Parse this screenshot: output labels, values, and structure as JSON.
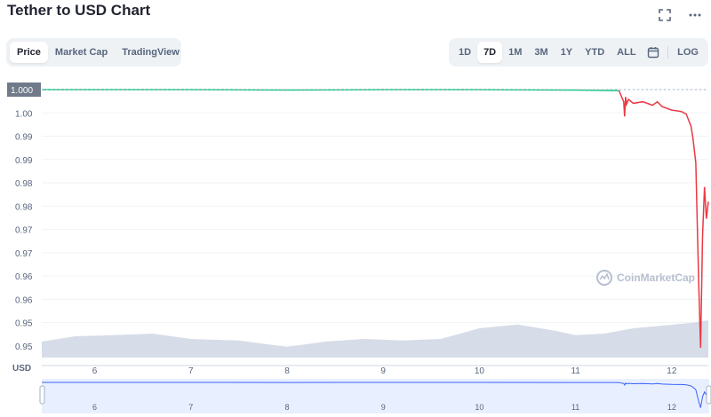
{
  "header": {
    "title": "Tether to USD Chart",
    "expand_icon": "expand-icon",
    "more_icon": "more-horizontal-icon"
  },
  "tabs_left": [
    {
      "label": "Price",
      "active": true
    },
    {
      "label": "Market Cap",
      "active": false
    },
    {
      "label": "TradingView",
      "active": false
    }
  ],
  "ranges": [
    {
      "label": "1D",
      "active": false
    },
    {
      "label": "7D",
      "active": true
    },
    {
      "label": "1M",
      "active": false
    },
    {
      "label": "3M",
      "active": false
    },
    {
      "label": "1Y",
      "active": false
    },
    {
      "label": "YTD",
      "active": false
    },
    {
      "label": "ALL",
      "active": false
    }
  ],
  "calendar_icon": "calendar-icon",
  "log_label": "LOG",
  "watermark": "CoinMarketCap",
  "colors": {
    "up": "#16c784",
    "down": "#ea3943",
    "accent": "#3861fb",
    "volume": "#cfd6e4"
  },
  "chart_data": {
    "type": "line",
    "y_axis_label": "USD",
    "yticks": [
      "1.000",
      "1.00",
      "0.99",
      "0.99",
      "0.98",
      "0.98",
      "0.97",
      "0.97",
      "0.96",
      "0.96",
      "0.95",
      "0.95"
    ],
    "xticks": [
      "6",
      "7",
      "8",
      "9",
      "10",
      "11",
      "12"
    ],
    "current_price_label": "1.000",
    "ylim": [
      0.945,
      1.0
    ],
    "grid": true,
    "series": [
      {
        "x": [
          5.45,
          6.0,
          7.0,
          8.0,
          9.0,
          10.0,
          11.0,
          11.45,
          11.5,
          11.51,
          11.52,
          11.53,
          11.55,
          11.6,
          11.7,
          11.8,
          11.85,
          11.9,
          12.0,
          12.1,
          12.15,
          12.2,
          12.22,
          12.25,
          12.28,
          12.3,
          12.32,
          12.34,
          12.36,
          12.38
        ],
        "y": [
          1.0,
          1.0,
          1.0,
          0.9999,
          1.0,
          1.0,
          0.9999,
          0.9998,
          0.9975,
          0.9945,
          0.9985,
          0.997,
          0.998,
          0.9972,
          0.9975,
          0.9968,
          0.9975,
          0.9965,
          0.9958,
          0.9955,
          0.995,
          0.9925,
          0.99,
          0.985,
          0.96,
          0.947,
          0.97,
          0.98,
          0.9735,
          0.977
        ]
      }
    ],
    "volume": {
      "x": [
        5.45,
        5.8,
        6.2,
        6.6,
        7.0,
        7.5,
        8.0,
        8.4,
        8.8,
        9.2,
        9.6,
        10.0,
        10.4,
        10.8,
        11.0,
        11.3,
        11.6,
        11.9,
        12.2,
        12.38
      ],
      "y": [
        0.3,
        0.4,
        0.42,
        0.45,
        0.35,
        0.32,
        0.2,
        0.3,
        0.35,
        0.32,
        0.35,
        0.55,
        0.62,
        0.5,
        0.42,
        0.45,
        0.55,
        0.6,
        0.65,
        0.7
      ]
    }
  }
}
